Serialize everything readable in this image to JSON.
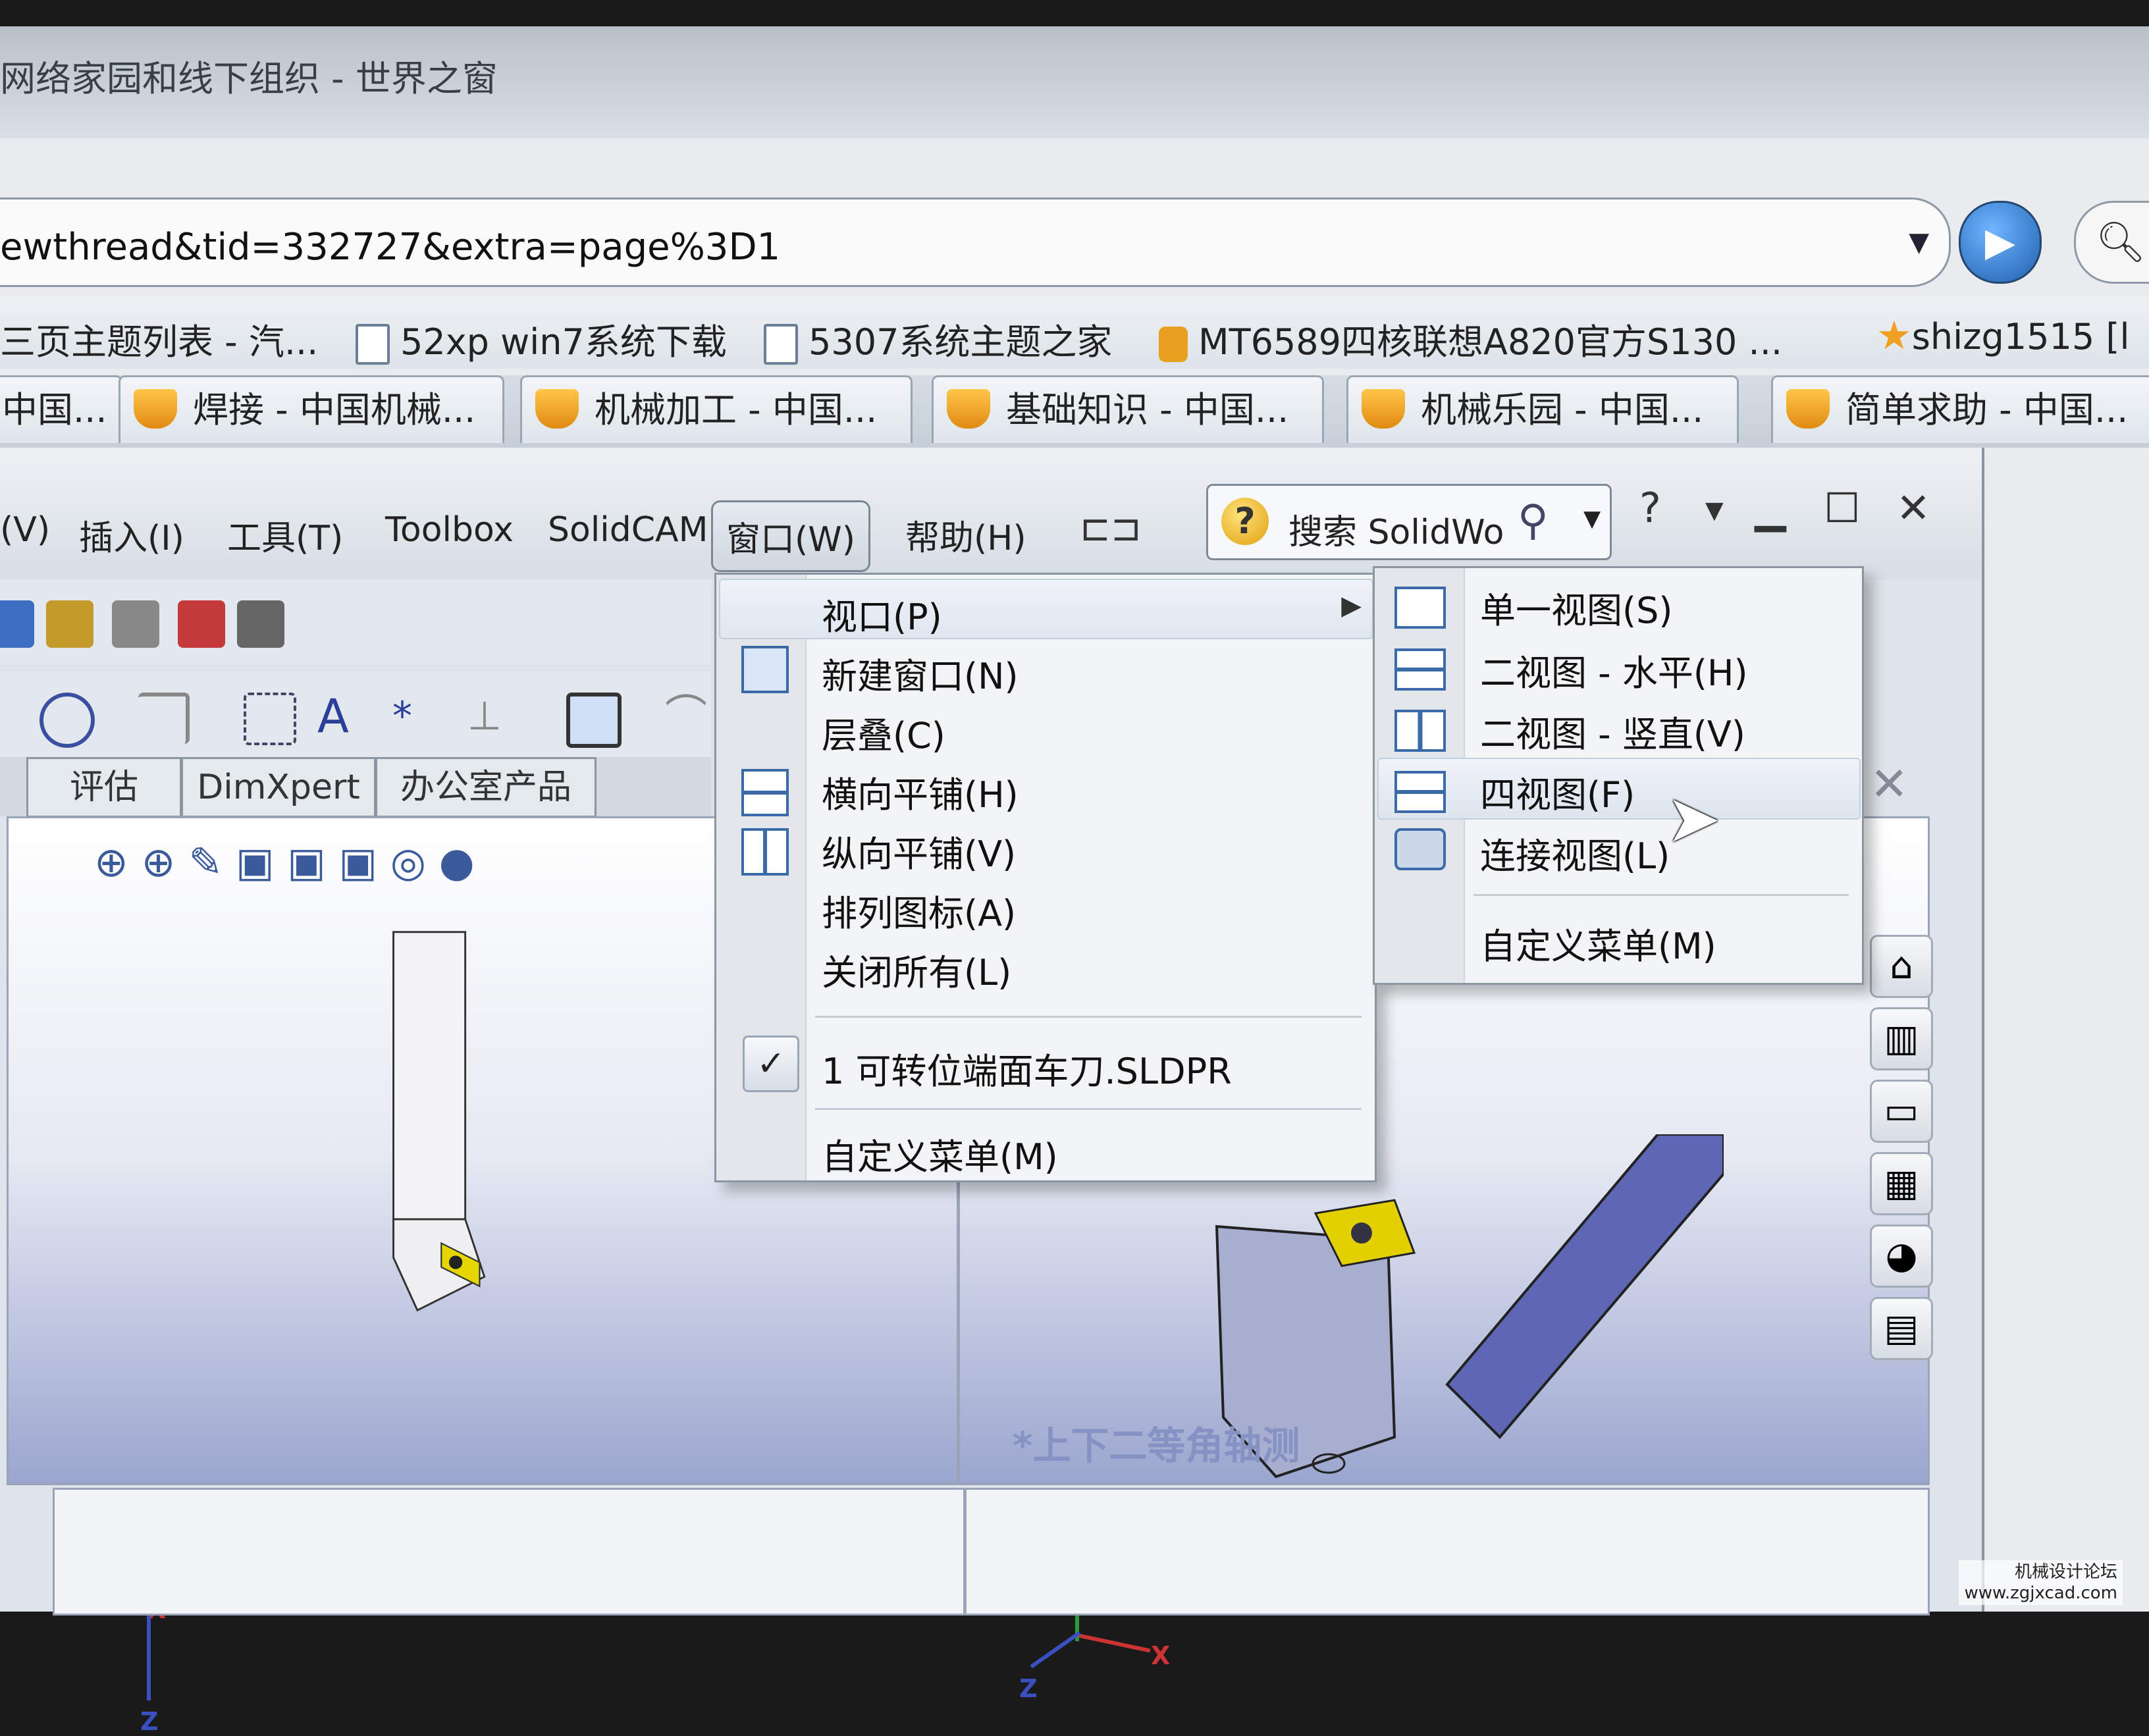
{
  "browser": {
    "title": "网络家园和线下组织 - 世界之窗",
    "url": "ewthread&tid=332727&extra=page%3D1",
    "favorites": [
      {
        "label": "三页主题列表 - 汽..."
      },
      {
        "label": "52xp win7系统下载"
      },
      {
        "label": "5307系统主题之家"
      },
      {
        "label": "MT6589四核联想A820官方S130 ..."
      },
      {
        "label": "shizg1515 [l"
      }
    ],
    "tabs": [
      {
        "label": "中国..."
      },
      {
        "label": "焊接 - 中国机械..."
      },
      {
        "label": "机械加工 - 中国..."
      },
      {
        "label": "基础知识 - 中国..."
      },
      {
        "label": "机械乐园 - 中国..."
      },
      {
        "label": "简单求助 - 中国..."
      }
    ]
  },
  "solidworks": {
    "menubar": {
      "items": [
        "(V)",
        "插入(I)",
        "工具(T)",
        "Toolbox",
        "SolidCAM",
        "窗口(W)",
        "帮助(H)"
      ]
    },
    "search_placeholder": "搜索 SolidWo",
    "command_tabs": [
      "评估",
      "DimXpert",
      "办公室产品"
    ],
    "window_menu": {
      "items": [
        {
          "label": "视口(P)"
        },
        {
          "label": "新建窗口(N)"
        },
        {
          "label": "层叠(C)"
        },
        {
          "label": "横向平铺(H)"
        },
        {
          "label": "纵向平铺(V)"
        },
        {
          "label": "排列图标(A)"
        },
        {
          "label": "关闭所有(L)"
        },
        {
          "label": "1 可转位端面车刀.SLDPR"
        },
        {
          "label": "自定义菜单(M)"
        }
      ]
    },
    "viewport_submenu": {
      "items": [
        {
          "label": "单一视图(S)"
        },
        {
          "label": "二视图 - 水平(H)"
        },
        {
          "label": "二视图 - 竖直(V)"
        },
        {
          "label": "四视图(F)"
        },
        {
          "label": "连接视图(L)"
        },
        {
          "label": "自定义菜单(M)"
        }
      ]
    },
    "viewport_label": "*上下二等角轴测",
    "axis": {
      "x": "X",
      "z": "Z"
    }
  },
  "watermark": {
    "line1": "机械设计论坛",
    "line2": "www.zgjxcad.com"
  }
}
